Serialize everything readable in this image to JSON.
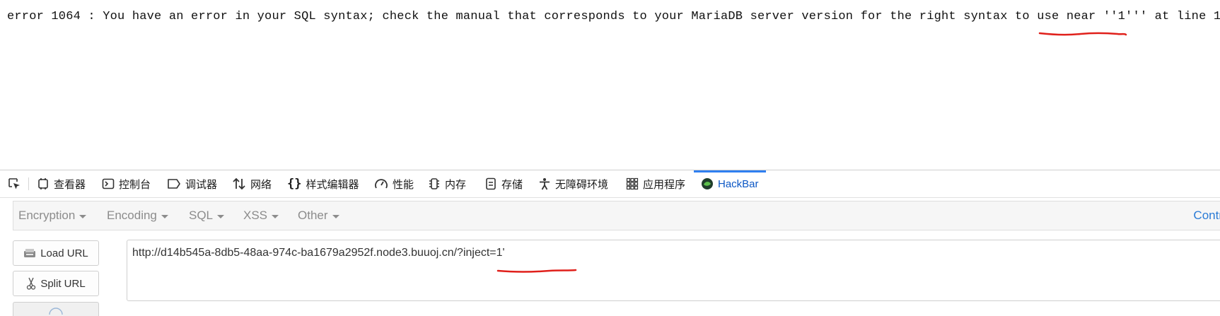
{
  "page": {
    "error_message": "error 1064 : You have an error in your SQL syntax; check the manual that corresponds to your MariaDB server version for the right syntax to use near ''1''' at line 1"
  },
  "devtools": {
    "tabs": [
      {
        "label": "查看器",
        "icon": "inspector-icon"
      },
      {
        "label": "控制台",
        "icon": "console-icon"
      },
      {
        "label": "调试器",
        "icon": "debugger-icon"
      },
      {
        "label": "网络",
        "icon": "network-icon"
      },
      {
        "label": "样式编辑器",
        "icon": "style-editor-icon"
      },
      {
        "label": "性能",
        "icon": "performance-icon"
      },
      {
        "label": "内存",
        "icon": "memory-icon"
      },
      {
        "label": "存储",
        "icon": "storage-icon"
      },
      {
        "label": "无障碍环境",
        "icon": "accessibility-icon"
      },
      {
        "label": "应用程序",
        "icon": "application-icon"
      },
      {
        "label": "HackBar",
        "icon": "hackbar-icon",
        "active": true
      }
    ],
    "accent_color": "#2f7ff0"
  },
  "hackbar": {
    "menus": [
      "Encryption",
      "Encoding",
      "SQL",
      "XSS",
      "Other"
    ],
    "right_link": "Contr",
    "buttons": {
      "load_url": "Load URL",
      "split_url": "Split URL"
    },
    "url": "http://d14b545a-8db5-48aa-974c-ba1679a2952f.node3.buuoj.cn/?inject=1'"
  },
  "annotation_color": "#e0201b"
}
